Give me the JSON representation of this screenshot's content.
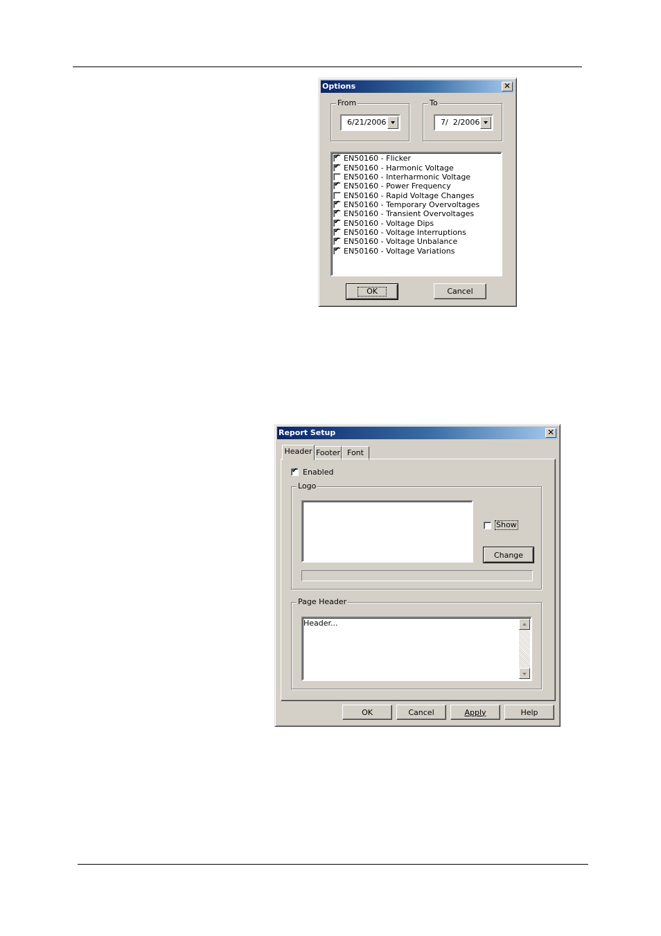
{
  "options": {
    "title": "Options",
    "close_glyph": "✕",
    "from": {
      "label": "From",
      "value": "6/21/2006"
    },
    "to": {
      "label": "To",
      "value": "7/  2/2006"
    },
    "items": [
      {
        "label": "EN50160 - Flicker",
        "checked": true
      },
      {
        "label": "EN50160 - Harmonic Voltage",
        "checked": true
      },
      {
        "label": "EN50160 - Interharmonic Voltage",
        "checked": false
      },
      {
        "label": "EN50160 - Power Frequency",
        "checked": true
      },
      {
        "label": "EN50160 - Rapid Voltage Changes",
        "checked": false
      },
      {
        "label": "EN50160 - Temporary Overvoltages",
        "checked": true
      },
      {
        "label": "EN50160 - Transient Overvoltages",
        "checked": true
      },
      {
        "label": "EN50160 - Voltage Dips",
        "checked": true
      },
      {
        "label": "EN50160 - Voltage Interruptions",
        "checked": true
      },
      {
        "label": "EN50160 - Voltage Unbalance",
        "checked": true
      },
      {
        "label": "EN50160 - Voltage Variations",
        "checked": true
      }
    ],
    "ok_label": "OK",
    "cancel_label": "Cancel"
  },
  "report": {
    "title": "Report Setup",
    "close_glyph": "✕",
    "tabs": [
      "Header",
      "Footer",
      "Font"
    ],
    "enabled_label": "Enabled",
    "enabled_checked": true,
    "logo_group": "Logo",
    "show_label": "Show",
    "show_checked": false,
    "change_label": "Change",
    "page_header_group": "Page Header",
    "header_text": "Header...",
    "buttons": {
      "ok": "OK",
      "cancel": "Cancel",
      "apply": "Apply",
      "help": "Help"
    }
  },
  "icons": {
    "tick": "✔",
    "dropdown": "chevron-down-icon",
    "close": "close-icon"
  }
}
